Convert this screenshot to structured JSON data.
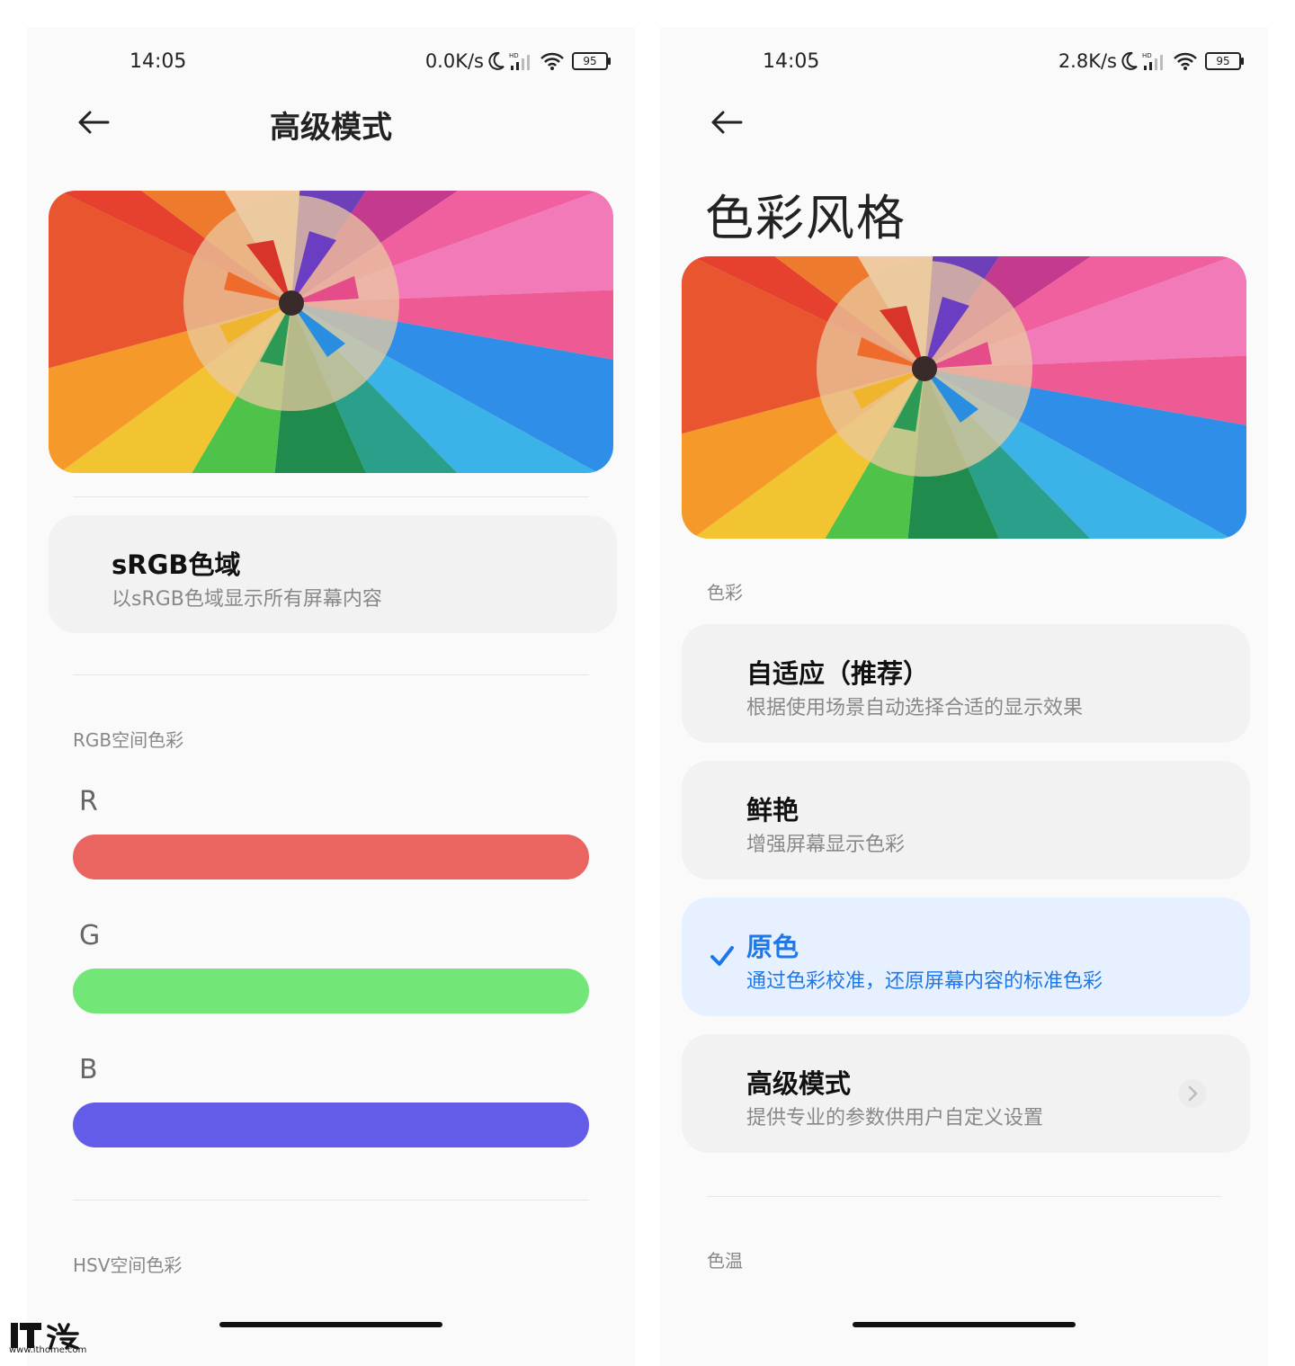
{
  "left_screen": {
    "status_bar": {
      "time": "14:05",
      "net_speed": "0.0K/s",
      "hd_label": "HD",
      "battery": "95"
    },
    "title": "高级模式",
    "srgb_card": {
      "title": "sRGB色域",
      "subtitle": "以sRGB色域显示所有屏幕内容"
    },
    "rgb_section": {
      "label": "RGB空间色彩",
      "channels": [
        {
          "letter": "R",
          "color": "#ea6560"
        },
        {
          "letter": "G",
          "color": "#72e676"
        },
        {
          "letter": "B",
          "color": "#635ce8"
        }
      ]
    },
    "hsv_section": {
      "label": "HSV空间色彩"
    }
  },
  "right_screen": {
    "status_bar": {
      "time": "14:05",
      "net_speed": "2.8K/s",
      "hd_label": "HD",
      "battery": "95"
    },
    "title": "色彩风格",
    "color_section_label": "色彩",
    "options": [
      {
        "title": "自适应（推荐）",
        "subtitle": "根据使用场景自动选择合适的显示效果",
        "selected": false
      },
      {
        "title": "鲜艳",
        "subtitle": "增强屏幕显示色彩",
        "selected": false
      },
      {
        "title": "原色",
        "subtitle": "通过色彩校准，还原屏幕内容的标准色彩",
        "selected": true
      },
      {
        "title": "高级模式",
        "subtitle": "提供专业的参数供用户自定义设置",
        "selected": false
      }
    ],
    "temperature_section_label": "色温"
  },
  "colors": {
    "accent_blue": "#1f78e6",
    "selected_card_bg": "#e6f0fe",
    "card_bg": "#f2f2f2"
  },
  "watermark": {
    "logo": "IT之家",
    "url": "www.ithome.com"
  }
}
